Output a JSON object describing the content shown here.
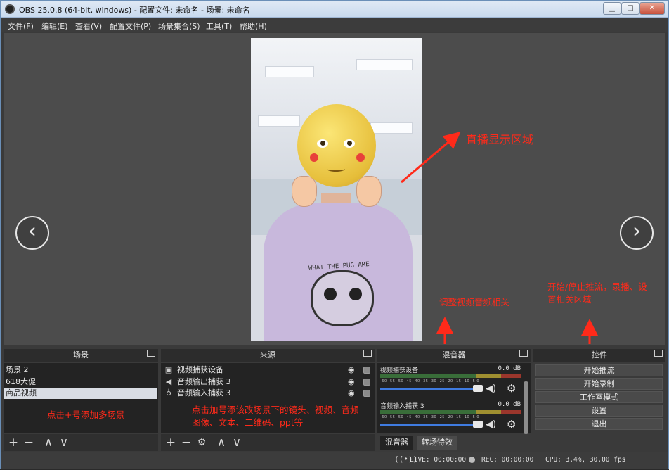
{
  "window": {
    "title": "OBS 25.0.8 (64-bit, windows) - 配置文件: 未命名 - 场景: 未命名",
    "min_label": "▁",
    "max_label": "□",
    "close_label": "✕"
  },
  "menu": [
    "文件(F)",
    "编辑(E)",
    "查看(V)",
    "配置文件(P)",
    "场景集合(S)",
    "工具(T)",
    "帮助(H)"
  ],
  "preview": {
    "shirt_text": "WHAT THE PUG ARE",
    "nav_prev": "‹",
    "nav_next": "›"
  },
  "annotations": {
    "live_area": "直播显示区域",
    "mixer_note": "调整视频音频相关",
    "controls_note_line1": "开始/停止推流，录播、设",
    "controls_note_line2": "置相关区域",
    "scenes_note": "点击+号添加多场景",
    "sources_note_line1": "点击加号添该改场景下的镜头、视频、音频",
    "sources_note_line2": "图像、文本、二维码、ppt等"
  },
  "scenes": {
    "title": "场景",
    "items": [
      "场景 2",
      "618大促",
      "商品视频"
    ],
    "selected_index": 2
  },
  "sources": {
    "title": "来源",
    "items": [
      {
        "label": "视频捕获设备",
        "icon": "camera-icon"
      },
      {
        "label": "音频输出捕获 3",
        "icon": "speaker-icon"
      },
      {
        "label": "音频输入捕获 3",
        "icon": "microphone-icon"
      }
    ]
  },
  "mixer": {
    "title": "混音器",
    "channels": [
      {
        "name": "视频捕获设备",
        "db": "0.0 dB"
      },
      {
        "name": "音频输入捕获 3",
        "db": "0.0 dB"
      }
    ],
    "scale": "-60 -55 -50 -45 -40 -35 -30 -25 -20 -15 -10 -5 0",
    "tabs": [
      "混音器",
      "转场特效"
    ]
  },
  "controls": {
    "title": "控件",
    "buttons": [
      "开始推流",
      "开始录制",
      "工作室模式",
      "设置",
      "退出"
    ]
  },
  "toolbar_glyphs": {
    "add": "+",
    "remove": "−",
    "up": "∧",
    "down": "∨",
    "settings": "⚙"
  },
  "status": {
    "live": "LIVE: 00:00:00",
    "rec": "REC: 00:00:00",
    "cpu": "CPU: 3.4%, 30.00 fps"
  },
  "colors": {
    "annotation": "#ff2a1a",
    "volume_slider": "#3f7be0",
    "window_background": "#3a3a3a"
  }
}
